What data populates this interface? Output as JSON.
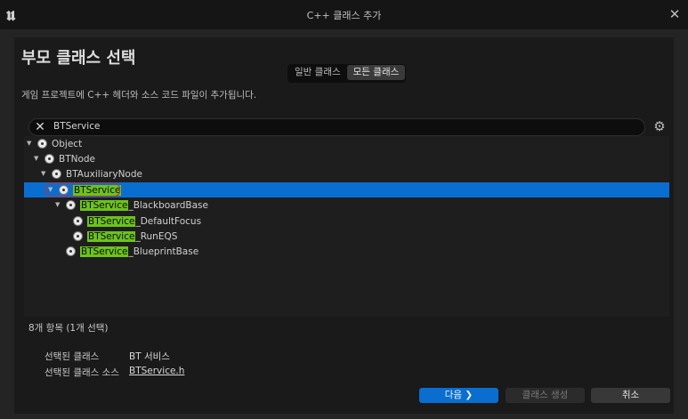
{
  "window": {
    "title": "C++ 클래스 추가",
    "logo_glyph": "𝖚",
    "close_glyph": "✕"
  },
  "page": {
    "heading": "부모 클래스 선택",
    "subtitle": "게임 프로젝트에 C++ 헤더와 소스 코드 파일이 추가됩니다.",
    "toggle": [
      "일반 클래스",
      "모든 클래스"
    ],
    "active_toggle": "모든 클래스"
  },
  "search": {
    "value": "BTService",
    "clear_glyph": "✕",
    "settings_glyph": "⚙"
  },
  "tree": {
    "expand_glyph": "▼",
    "rows": [
      {
        "pre": "",
        "match": "",
        "post": "Object"
      },
      {
        "pre": "",
        "match": "",
        "post": "BTNode"
      },
      {
        "pre": "",
        "match": "",
        "post": "BTAuxiliaryNode"
      },
      {
        "pre": "",
        "match": "BTService",
        "post": ""
      },
      {
        "pre": "",
        "match": "BTService",
        "post": "_BlackboardBase"
      },
      {
        "pre": "",
        "match": "BTService",
        "post": "_DefaultFocus"
      },
      {
        "pre": "",
        "match": "BTService",
        "post": "_RunEQS"
      },
      {
        "pre": "",
        "match": "BTService",
        "post": "_BlueprintBase"
      }
    ],
    "selected_index": 3
  },
  "status": {
    "count": "8개 항목 (1개 선택)"
  },
  "info": {
    "selected_class_label": "선택된 클래스",
    "selected_class_value": "BT 서비스",
    "selected_source_label": "선택된 클래스 소스",
    "selected_source_value": "BTService.h"
  },
  "buttons": {
    "next": "다음 ❯",
    "create": "클래스 생성",
    "cancel": "취소"
  },
  "colors": {
    "accent": "#0a6ed1",
    "highlight": "#6cc31c",
    "selection_outline": "#cc2a2a"
  }
}
